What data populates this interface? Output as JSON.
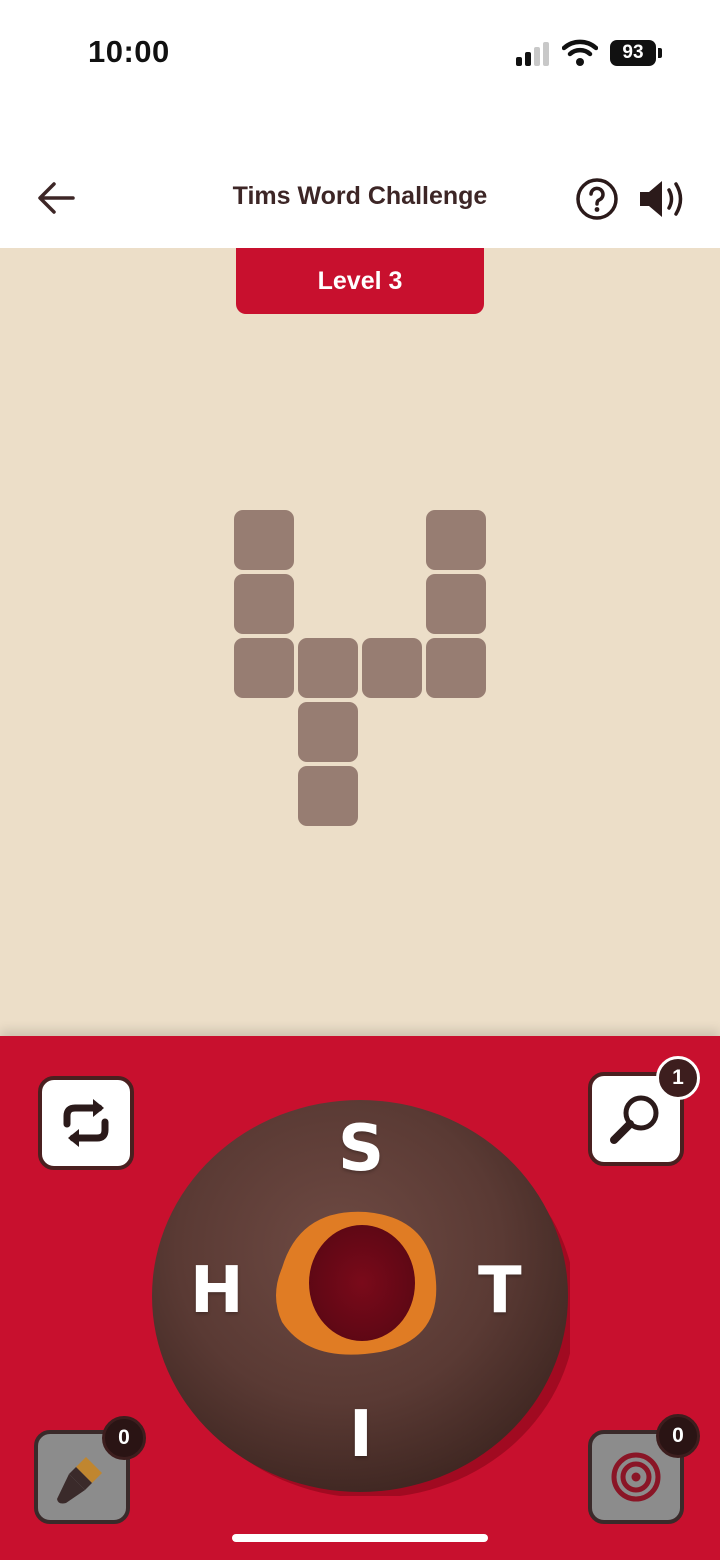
{
  "status_bar": {
    "time": "10:00",
    "battery": "93"
  },
  "header": {
    "title": "Tims Word Challenge",
    "back_icon": "arrow-left-icon",
    "help_icon": "question-circle-icon",
    "sound_icon": "speaker-icon"
  },
  "board": {
    "level_label": "Level 3"
  },
  "controls": {
    "shuffle_icon": "shuffle-icon",
    "hint_icon": "magnifier-icon",
    "hint_count": "1",
    "paint_icon": "paintbrush-icon",
    "paint_count": "0",
    "target_icon": "target-icon",
    "target_count": "0",
    "letters": [
      "S",
      "H",
      "T",
      "I"
    ]
  },
  "colors": {
    "brand_red": "#c8102e",
    "board_bg": "#ecdec8",
    "tile": "#977d72",
    "donut_chocolate": "#5a3a34"
  }
}
